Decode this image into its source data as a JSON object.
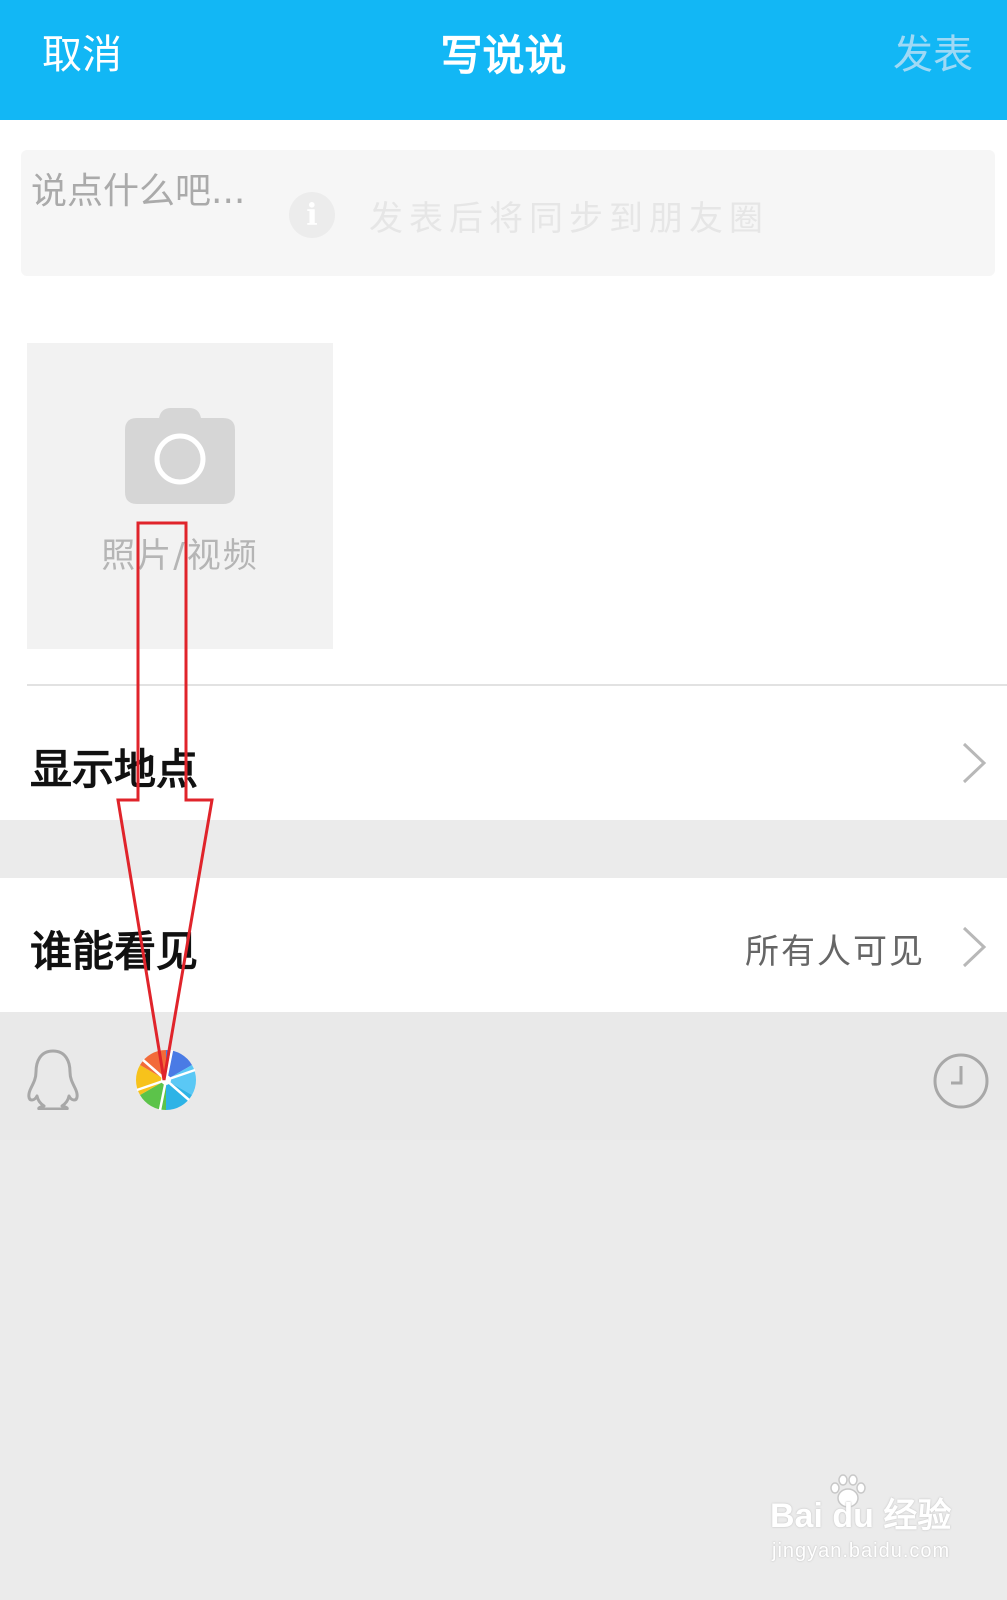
{
  "header": {
    "cancel_label": "取消",
    "title": "写说说",
    "publish_label": "发表"
  },
  "compose": {
    "placeholder": "说点什么吧...",
    "sync_hint": "发表后将同步到朋友圈"
  },
  "media": {
    "label": "照片/视频"
  },
  "options": {
    "location_label": "显示地点",
    "visibility_label": "谁能看见",
    "visibility_value": "所有人可见"
  },
  "toolbar": {
    "icons": [
      "qq-icon",
      "photo-aperture-icon",
      "clock-icon"
    ]
  },
  "watermark": {
    "brand": "Bai du 经验",
    "url": "jingyan.baidu.com"
  },
  "colors": {
    "header_bg": "#12b7f5",
    "annotation_arrow": "#e0242b",
    "page_bg": "#ebebeb"
  }
}
